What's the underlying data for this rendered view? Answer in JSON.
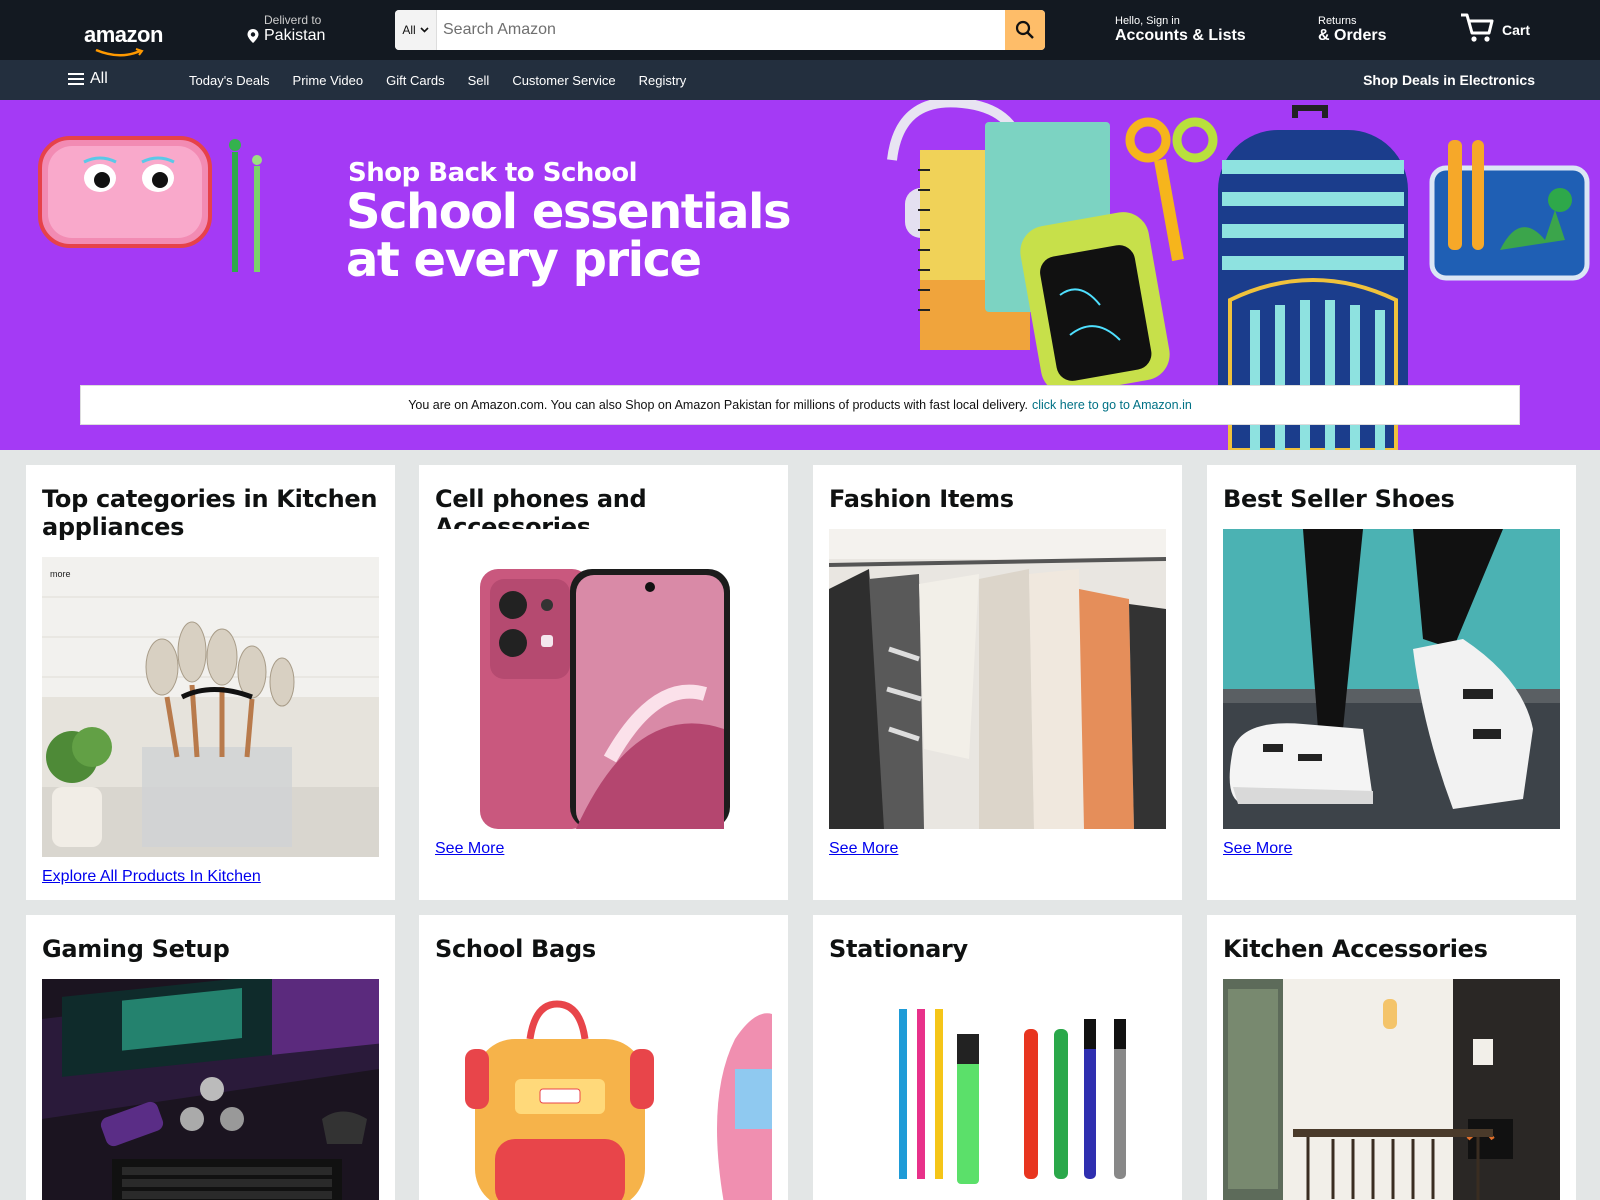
{
  "header": {
    "logo_text": "amazon",
    "deliver_line1": "Deliverd to",
    "deliver_line2": "Pakistan",
    "search_category": "All",
    "search_placeholder": "Search Amazon",
    "account_line1": "Hello, Sign in",
    "account_line2": "Accounts & Lists",
    "orders_line1": "Returns",
    "orders_line2": "& Orders",
    "cart_label": "Cart"
  },
  "nav": {
    "all_label": "All",
    "links": [
      "Today's Deals",
      "Prime Video",
      "Gift Cards",
      "Sell",
      "Customer Service",
      "Registry"
    ],
    "deals_label": "Shop Deals in Electronics"
  },
  "hero": {
    "kicker": "Shop Back to School",
    "title_line1": "School essentials",
    "title_line2": "at every price",
    "notice_text": "You are on Amazon.com. You can also Shop on Amazon Pakistan for millions of products with fast local delivery.",
    "notice_link": "click here to go to Amazon.in"
  },
  "cards": [
    {
      "title": "Top categories in Kitchen appliances",
      "link": "Explore All Products In Kitchen",
      "image": "kitchen-utensils-image",
      "watermark": "more"
    },
    {
      "title": "Cell phones and Accessories",
      "link": "See More",
      "image": "pink-phone-image"
    },
    {
      "title": "Fashion Items",
      "link": "See More",
      "image": "clothes-rack-image"
    },
    {
      "title": "Best Seller Shoes",
      "link": "See More",
      "image": "sneaker-image"
    },
    {
      "title": "Gaming Setup",
      "link": "",
      "image": "gaming-desk-image"
    },
    {
      "title": "School Bags",
      "link": "",
      "image": "backpack-image"
    },
    {
      "title": "Stationary",
      "link": "",
      "image": "pens-markers-image"
    },
    {
      "title": "Kitchen Accessories",
      "link": "",
      "image": "dining-room-image"
    }
  ],
  "colors": {
    "nav_dark": "#131921",
    "nav_secondary": "#232f3e",
    "search_button": "#febd69",
    "hero_purple": "#a43af5",
    "link_blue": "#0000ee",
    "notice_link": "#007185"
  }
}
